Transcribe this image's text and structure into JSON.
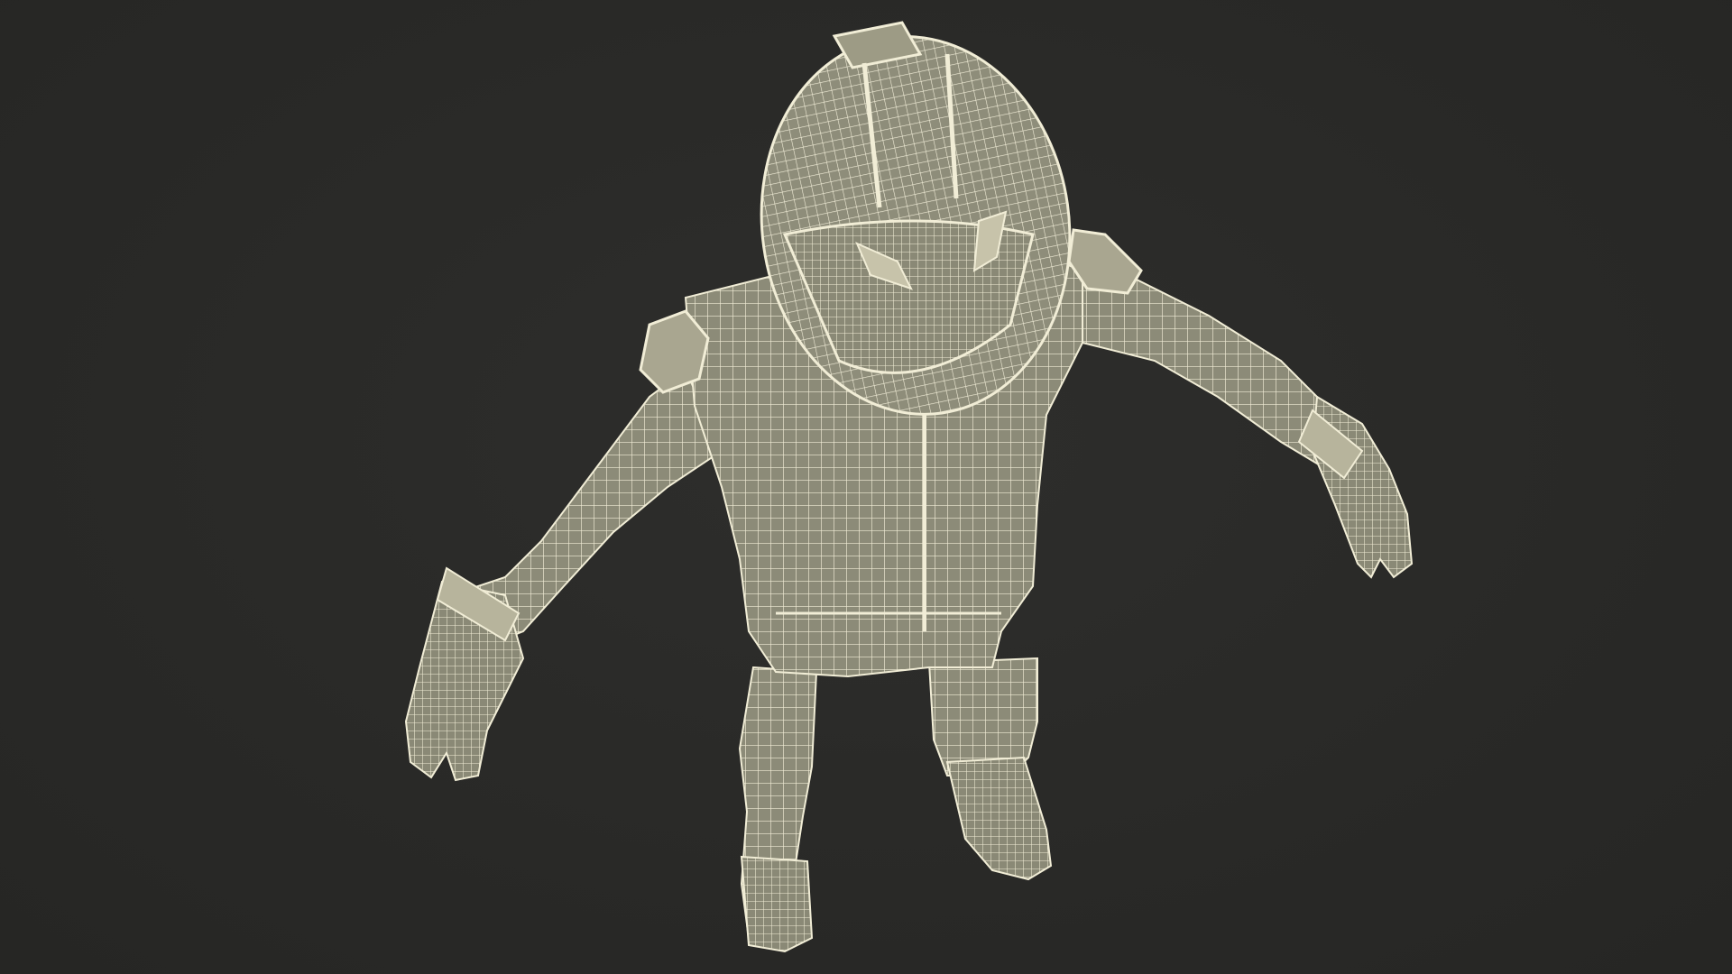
{
  "scene": {
    "subject": "wireframe-figure-in-racing-suit-and-helmet",
    "background_color": "#2a2a28",
    "mesh_fill_color": "#8c8b78",
    "wire_color": "#f1edd6"
  }
}
